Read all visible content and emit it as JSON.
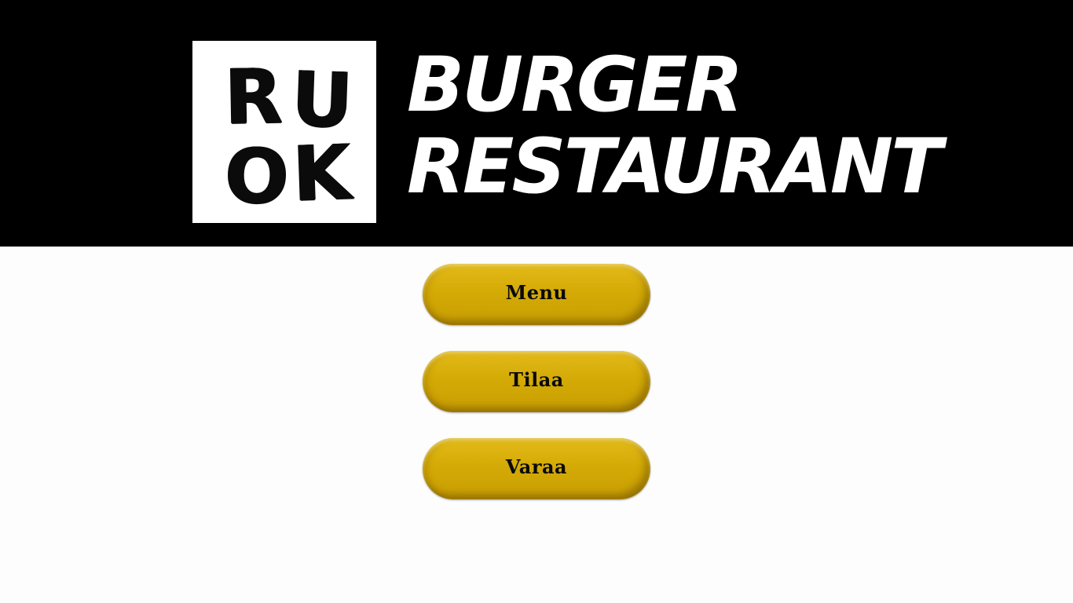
{
  "header": {
    "logo": {
      "letters": [
        "R",
        "U",
        "O",
        "K"
      ]
    },
    "brand": {
      "line1": "BURGER",
      "line2": "RESTAURANT"
    }
  },
  "nav": {
    "buttons": [
      {
        "label": "Menu"
      },
      {
        "label": "Tilaa"
      },
      {
        "label": "Varaa"
      }
    ]
  },
  "colors": {
    "header_background": "#000000",
    "page_background": "#fdfdfd",
    "button_accent": "#d4aa06",
    "button_text": "#0a0a0a"
  }
}
